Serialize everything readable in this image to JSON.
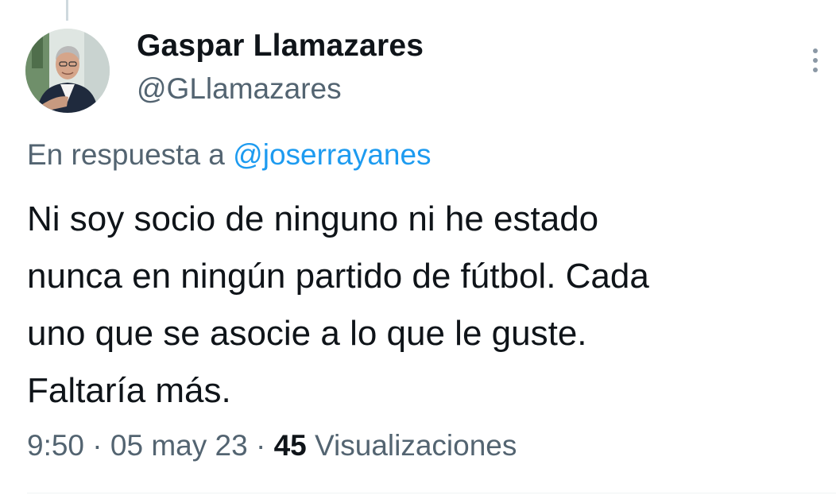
{
  "author": {
    "display_name": "Gaspar Llamazares",
    "handle": "@GLlamazares"
  },
  "reply": {
    "prefix": "En respuesta a ",
    "to_handle": "@joserrayanes"
  },
  "tweet": {
    "text": "Ni soy socio de ninguno ni he estado\nnunca en ningún partido de fútbol. Cada\nuno que se asocie a lo que le guste.\nFaltaría más."
  },
  "meta": {
    "time": "9:50",
    "separator": " · ",
    "date": "05 may 23",
    "views_count": "45",
    "views_label": " Visualizaciones"
  },
  "icons": {
    "more": "more-vertical-icon",
    "avatar": "avatar-photo"
  },
  "colors": {
    "text_primary": "#0f1419",
    "text_secondary": "#536471",
    "link": "#1d9bf0"
  }
}
